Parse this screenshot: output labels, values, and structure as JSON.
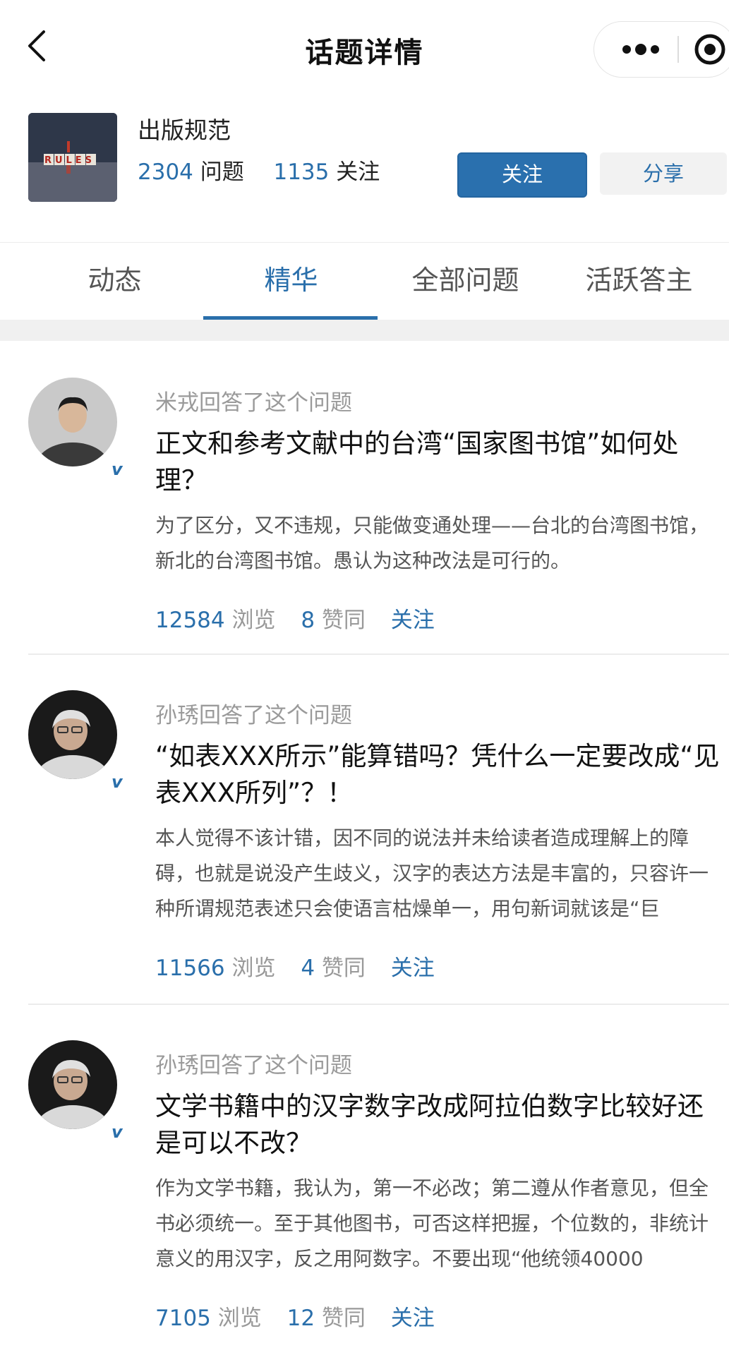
{
  "nav": {
    "title": "话题详情"
  },
  "topic": {
    "name": "出版规范",
    "cover_text": "RULES",
    "question_count": "2304",
    "question_label": "问题",
    "follower_count": "1135",
    "follower_label": "关注",
    "follow_button": "关注",
    "share_button": "分享"
  },
  "tabs": [
    {
      "label": "动态"
    },
    {
      "label": "精华"
    },
    {
      "label": "全部问题"
    },
    {
      "label": "活跃答主"
    }
  ],
  "active_tab": "精华",
  "feed": [
    {
      "actor": "米戎回答了这个问题",
      "verified": "v",
      "title": "正文和参考文献中的台湾“国家图书馆”如何处理？",
      "excerpt": "为了区分，又不违规，只能做变通处理——台北的台湾图书馆，新北的台湾图书馆。愚认为这种改法是可行的。",
      "views": "12584",
      "views_label": "浏览",
      "likes": "8",
      "likes_label": "赞同",
      "follow_label": "关注"
    },
    {
      "actor": "孙琇回答了这个问题",
      "verified": "v",
      "title": "“如表XXX所示”能算错吗？凭什么一定要改成“见表XXX所列”？！",
      "excerpt": "本人觉得不该计错，因不同的说法并未给读者造成理解上的障碍，也就是说没产生歧义，汉字的表达方法是丰富的，只容许一种所谓规范表述只会使语言枯燥单一，用句新词就该是“巨",
      "views": "11566",
      "views_label": "浏览",
      "likes": "4",
      "likes_label": "赞同",
      "follow_label": "关注"
    },
    {
      "actor": "孙琇回答了这个问题",
      "verified": "v",
      "title": "文学书籍中的汉字数字改成阿拉伯数字比较好还是可以不改？",
      "excerpt": "作为文学书籍，我认为，第一不必改；第二遵从作者意见，但全书必须统一。至于其他图书，可否这样把握，个位数的，非统计意义的用汉字，反之用阿数字。不要出现“他统领40000",
      "views": "7105",
      "views_label": "浏览",
      "likes": "12",
      "likes_label": "赞同",
      "follow_label": "关注"
    }
  ],
  "colors": {
    "accent": "#2a6fab",
    "follow_button_bg": "#2a70ae",
    "share_button_bg": "#f2f2f2",
    "muted_text": "#9a9a9a"
  }
}
